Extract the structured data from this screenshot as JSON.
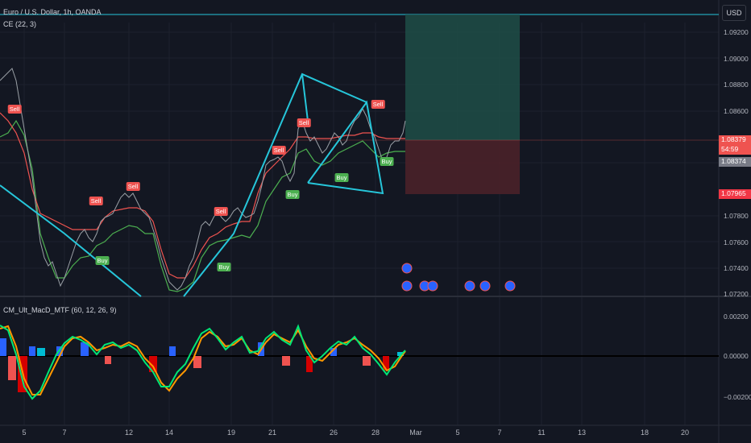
{
  "header": {
    "symbol_title": "Euro / U.S. Dollar, 1h, OANDA",
    "indicator_ce": "CE (22, 3)",
    "indicator_macd": "CM_Ult_MacD_MTF (60, 12, 26, 9)",
    "currency_button": "USD"
  },
  "price_axis": [
    "1.09200",
    "1.09000",
    "1.08800",
    "1.08600",
    "1.08379",
    "1.07800",
    "1.07600",
    "1.07400",
    "1.07200"
  ],
  "price_tags": {
    "last_price": "1.08379",
    "countdown": "54:59",
    "ce_level": "1.08374",
    "stop_level": "1.07965"
  },
  "macd_axis": [
    "0.00200",
    "0.00000",
    "−0.00200"
  ],
  "time_axis": [
    "5",
    "7",
    "12",
    "14",
    "19",
    "21",
    "26",
    "28",
    "Mar",
    "5",
    "7",
    "11",
    "13",
    "18",
    "20"
  ],
  "signals": {
    "sell": "Sell",
    "buy": "Buy"
  },
  "colors": {
    "background": "#131722",
    "pattern": "#26c6da",
    "sell": "#ef5350",
    "buy": "#4caf50",
    "target_zone": "#1e4d46",
    "stop_zone": "#4a2129",
    "macd_line": "#ff9800",
    "macd_signal": "#00e676"
  }
}
